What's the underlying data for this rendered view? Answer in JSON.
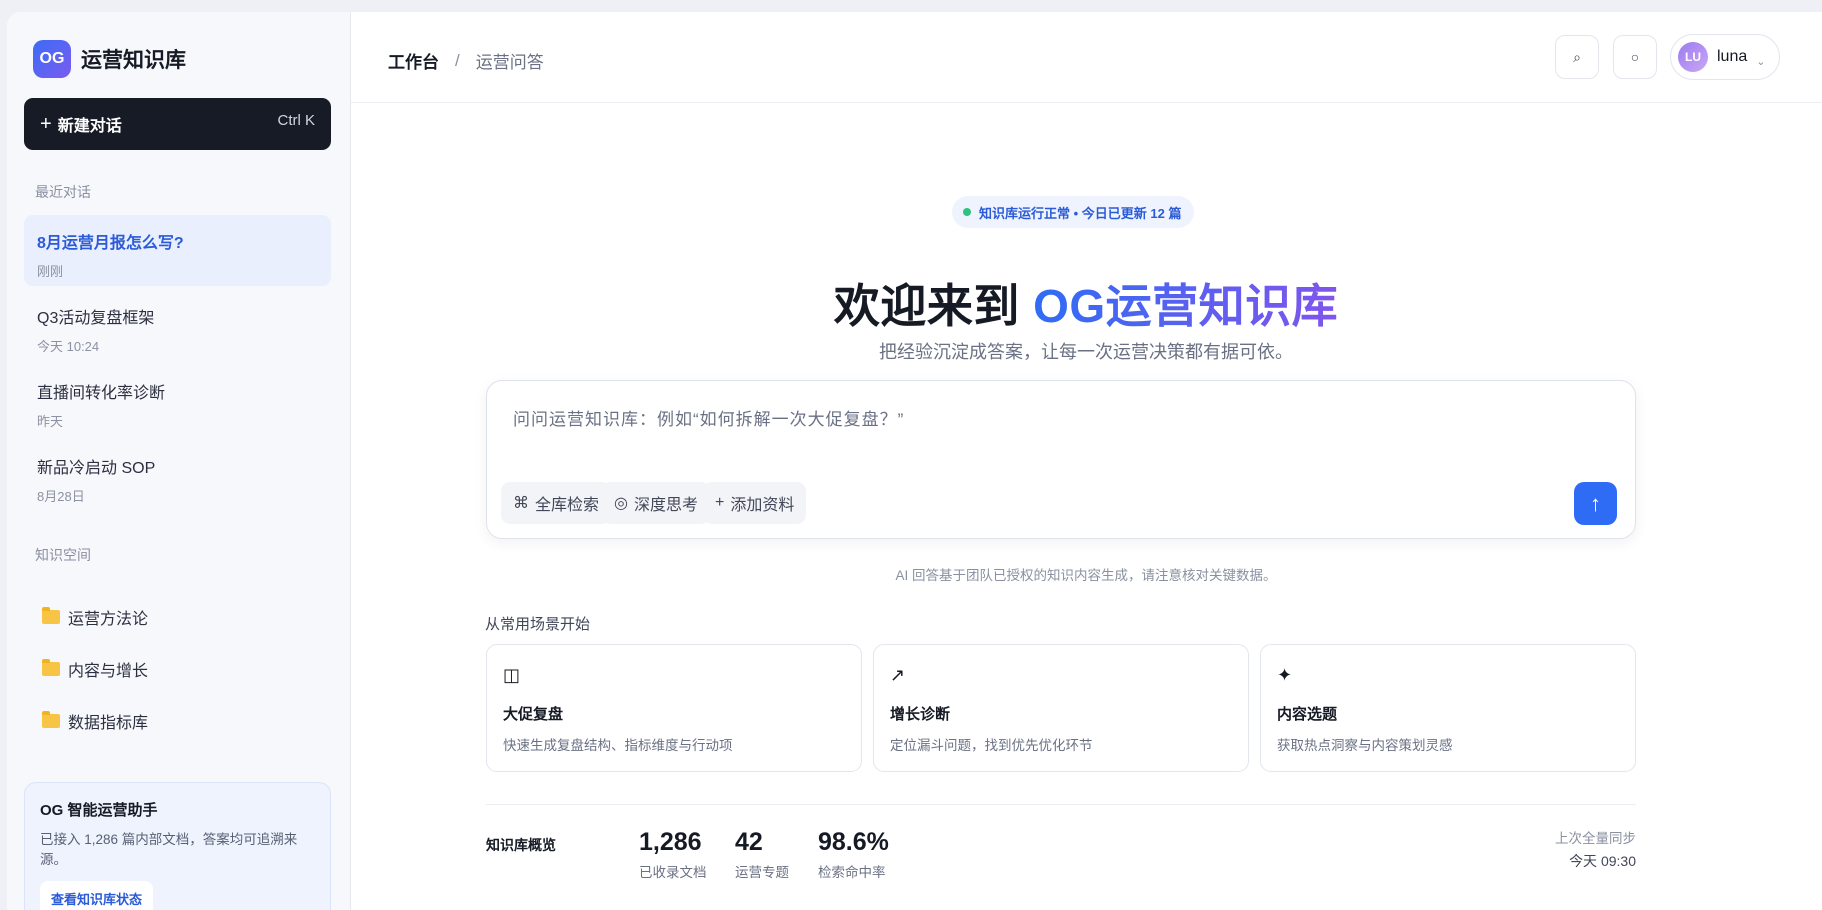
{
  "brand": {
    "logo": "OG",
    "name": "运营知识库"
  },
  "new_chat": {
    "icon": "+",
    "label": "新建对话",
    "shortcut": "Ctrl K"
  },
  "sidebar": {
    "recent_title": "最近对话",
    "conversations": [
      {
        "title": "8月运营月报怎么写?",
        "time": "刚刚"
      },
      {
        "title": "Q3活动复盘框架",
        "time": "今天 10:24"
      },
      {
        "title": "直播间转化率诊断",
        "time": "昨天"
      },
      {
        "title": "新品冷启动 SOP",
        "time": "8月28日"
      }
    ],
    "spaces_title": "知识空间",
    "spaces": [
      {
        "name": "运营方法论",
        "icon": "folder-icon"
      },
      {
        "name": "内容与增长",
        "icon": "folder-icon"
      },
      {
        "name": "数据指标库",
        "icon": "folder-icon"
      }
    ],
    "assistant": {
      "title": "OG 智能运营助手",
      "desc": "已接入 1,286 篇内部文档，答案均可追溯来源。",
      "button": "查看知识库状态"
    }
  },
  "topbar": {
    "breadcrumb_root": "工作台",
    "breadcrumb_sep": "/",
    "breadcrumb_current": "运营问答",
    "search_icon": "⌕",
    "theme_icon": "○",
    "user": {
      "initials": "LU",
      "name": "luna",
      "chevron": "⌄"
    }
  },
  "main": {
    "status": "知识库运行正常 • 今日已更新 12 篇",
    "hero_prefix": "欢迎来到 ",
    "hero_highlight": "OG运营知识库",
    "subtitle": "把经验沉淀成答案，让每一次运营决策都有据可依。",
    "composer": {
      "placeholder": "问问运营知识库：例如“如何拆解一次大促复盘？”",
      "chips": [
        {
          "icon": "⌘",
          "label": "全库检索"
        },
        {
          "icon": "◎",
          "label": "深度思考"
        },
        {
          "icon": "+",
          "label": "添加资料"
        }
      ],
      "send_icon": "↑"
    },
    "disclaimer": "AI 回答基于团队已授权的知识内容生成，请注意核对关键数据。",
    "scenarios_title": "从常用场景开始",
    "scenarios": [
      {
        "icon": "◫",
        "title": "大促复盘",
        "desc": "快速生成复盘结构、指标维度与行动项"
      },
      {
        "icon": "↗",
        "title": "增长诊断",
        "desc": "定位漏斗问题，找到优先优化环节"
      },
      {
        "icon": "✦",
        "title": "内容选题",
        "desc": "获取热点洞察与内容策划灵感"
      }
    ],
    "overview": {
      "label": "知识库概览",
      "stats": [
        {
          "value": "1,286",
          "label": "已收录文档"
        },
        {
          "value": "42",
          "label": "运营专题"
        },
        {
          "value": "98.6%",
          "label": "检索命中率"
        }
      ],
      "sync_label": "上次全量同步",
      "sync_time": "今天 09:30"
    }
  }
}
